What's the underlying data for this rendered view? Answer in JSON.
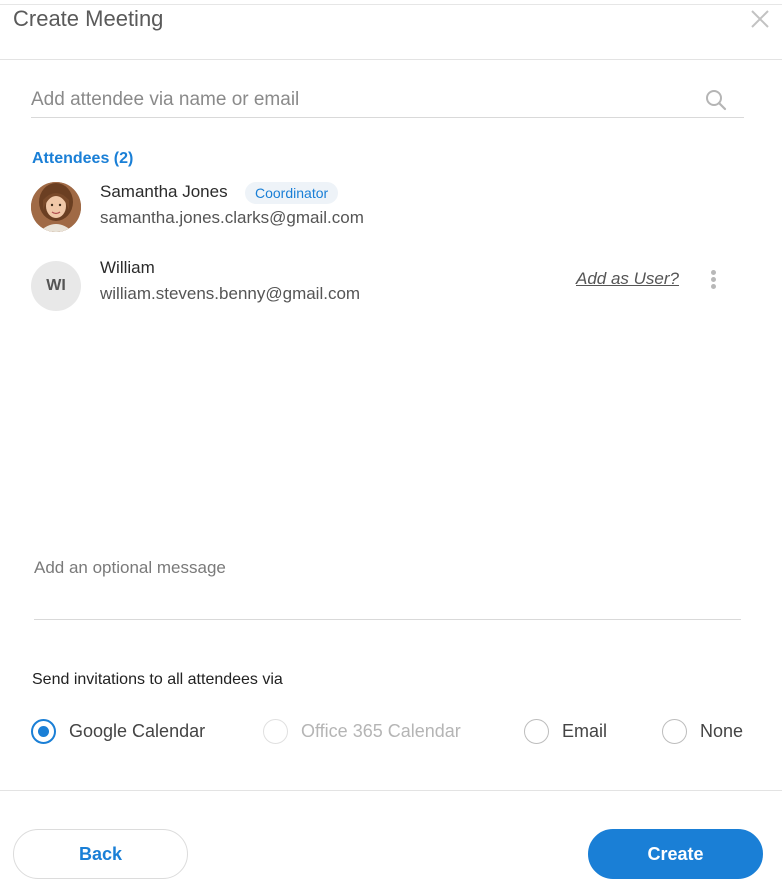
{
  "dialog": {
    "title": "Create Meeting",
    "close_icon": "close-icon"
  },
  "search": {
    "placeholder": "Add attendee via name or email",
    "value": "",
    "icon": "search-icon"
  },
  "attendees": {
    "heading": "Attendees (2)",
    "items": [
      {
        "name": "Samantha Jones",
        "email": "samantha.jones.clarks@gmail.com",
        "badge": "Coordinator",
        "avatar": "profile-photo"
      },
      {
        "name": "William",
        "email": "william.stevens.benny@gmail.com",
        "initials": "WI",
        "action": "Add as User?",
        "menu_icon": "more-vertical-icon"
      }
    ]
  },
  "message": {
    "placeholder": "Add an optional message",
    "value": ""
  },
  "invitations": {
    "label": "Send invitations to all attendees via",
    "options": [
      {
        "label": "Google Calendar",
        "selected": true,
        "disabled": false
      },
      {
        "label": "Office 365 Calendar",
        "selected": false,
        "disabled": true
      },
      {
        "label": "Email",
        "selected": false,
        "disabled": false
      },
      {
        "label": "None",
        "selected": false,
        "disabled": false
      }
    ]
  },
  "footer": {
    "back_label": "Back",
    "create_label": "Create"
  },
  "colors": {
    "accent": "#1a7fd6",
    "badge_bg": "#eef3f8",
    "divider": "#e3e3e3"
  }
}
